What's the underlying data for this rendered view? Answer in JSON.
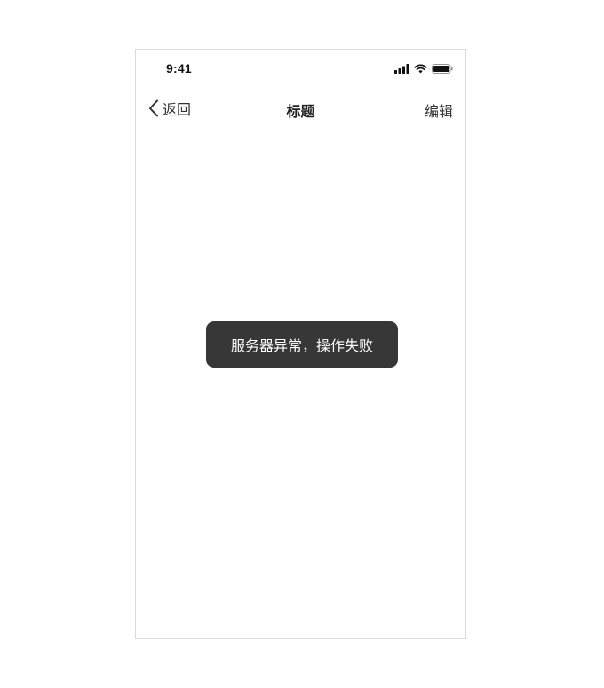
{
  "status_bar": {
    "time": "9:41",
    "icons": [
      "signal-icon",
      "wifi-icon",
      "battery-icon"
    ]
  },
  "nav": {
    "back_label": "返回",
    "title": "标题",
    "edit_label": "编辑"
  },
  "toast": {
    "message": "服务器异常，操作失败"
  },
  "colors": {
    "toast_background": "#373737",
    "toast_text": "#ffffff",
    "frame_border": "#d9d9d9"
  }
}
